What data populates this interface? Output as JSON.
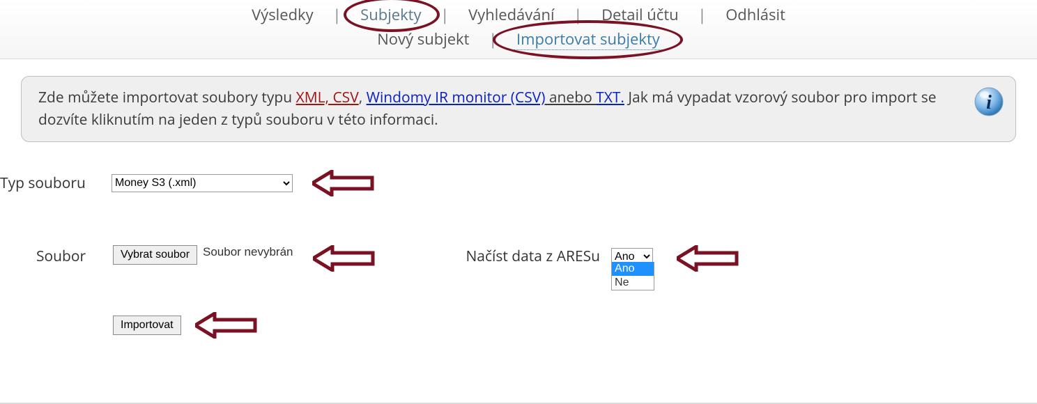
{
  "nav": {
    "items": [
      "Výsledky",
      "Subjekty",
      "Vyhledávání",
      "Detail účtu",
      "Odhlásit"
    ],
    "sub_items": [
      "Nový subjekt",
      "Importovat subjekty"
    ]
  },
  "info": {
    "t1": "Zde můžete importovat soubory typu ",
    "link_xml_csv": "XML, CSV",
    "comma": ", ",
    "link_windomy": "Windomy IR monitor (CSV)",
    "nebo": " anebo ",
    "link_txt": "TXT.",
    "t2": " Jak má vypadat vzorový soubor pro import se dozvíte kliknutím na jeden z typů souboru v této informaci."
  },
  "form": {
    "typ_label": "Typ souboru",
    "typ_value": "Money S3 (.xml)",
    "soubor_label": "Soubor",
    "choose_file_btn": "Vybrat soubor",
    "file_status": "Soubor nevybrán",
    "ares_label": "Načíst data z ARESu",
    "ares_value": "Ano",
    "ares_options": [
      "Ano",
      "Ne"
    ],
    "import_btn": "Importovat"
  }
}
